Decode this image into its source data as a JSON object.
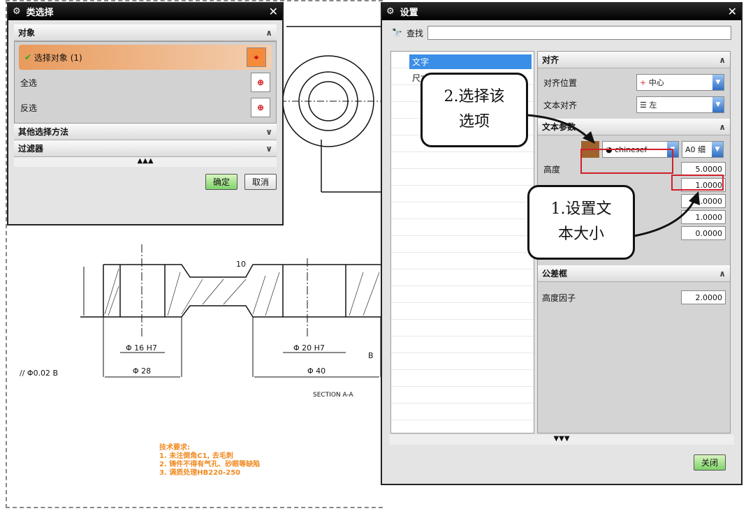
{
  "class_dialog": {
    "title": "类选择",
    "section_object": "对象",
    "select_object": "选择对象 (1)",
    "select_all": "全选",
    "invert": "反选",
    "other_methods": "其他选择方法",
    "filter": "过滤器",
    "ok": "确定",
    "cancel": "取消"
  },
  "settings_dialog": {
    "title": "设置",
    "find_label": "查找",
    "find_value": "",
    "tree": [
      "文字",
      "尺寸"
    ],
    "align_section": "对齐",
    "align_position_label": "对齐位置",
    "align_position_value": "中心",
    "text_align_label": "文本对齐",
    "text_align_value": "左",
    "text_params_section": "文本参数",
    "font_value": "chinesef",
    "style_value": "A0 细",
    "height_label": "高度",
    "values": [
      "5.0000",
      "1.0000",
      "1.0000",
      "1.0000",
      "0.0000"
    ],
    "tolerance_section": "公差框",
    "height_factor_label": "高度因子",
    "height_factor_value": "2.0000",
    "close": "关闭",
    "text_color": "#a0622d"
  },
  "callouts": {
    "step2": [
      "2.选择该",
      "选项"
    ],
    "step1": [
      "1.设置文",
      "本大小"
    ]
  },
  "drawing": {
    "dim1": "Φ 28",
    "dim2": "Φ 40",
    "dim3": "Φ 16 H7",
    "dim4": "Φ 20 H7",
    "tol": "// Φ0.02 B",
    "datum": "B",
    "section": "SECTION A-A",
    "dim_h": "10",
    "notes": [
      "技术要求:",
      "1. 未注倒角C1, 去毛刺",
      "2. 铸件不得有气孔、砂眼等缺陷",
      "3. 调质处理HB220-250"
    ]
  }
}
